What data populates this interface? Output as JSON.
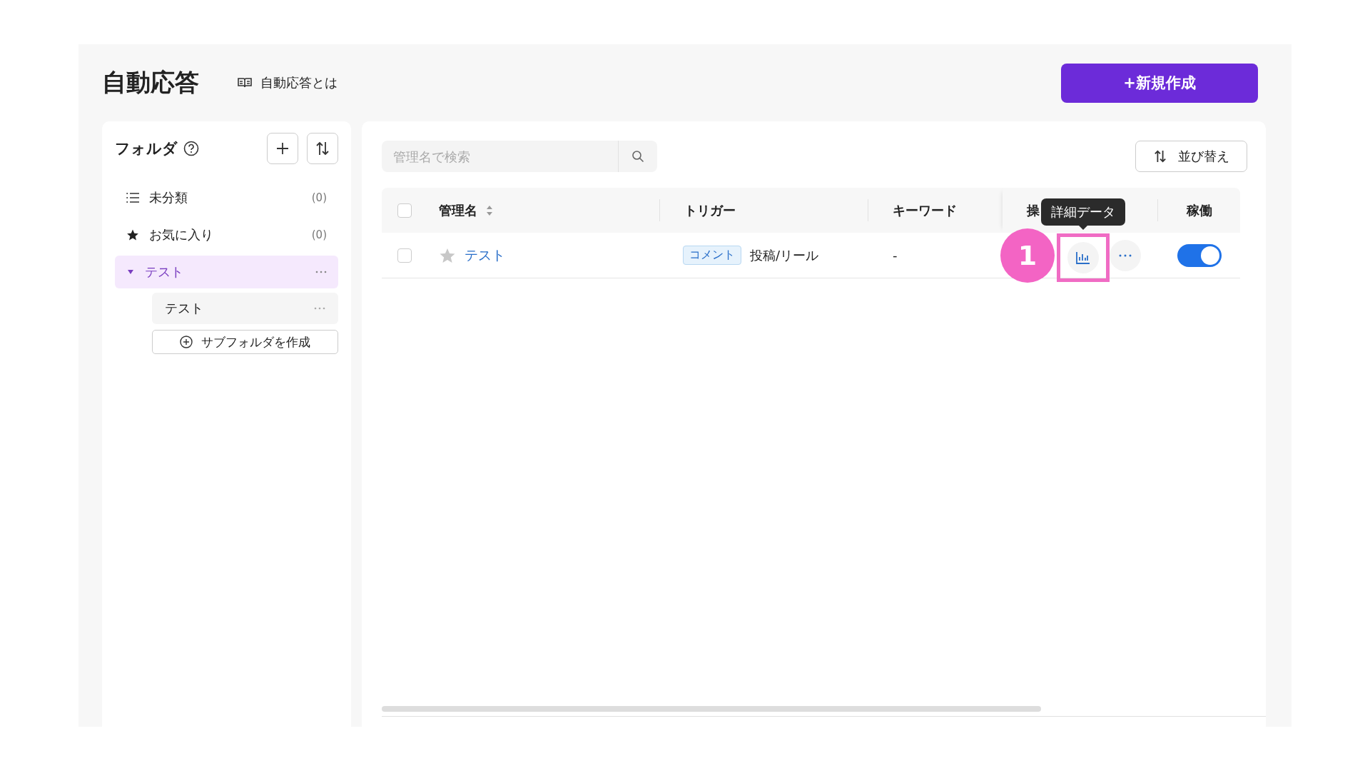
{
  "page": {
    "title": "自動応答",
    "help_link": "自動応答とは",
    "new_button": "+新規作成"
  },
  "sidebar": {
    "title": "フォルダ",
    "items": [
      {
        "kind": "uncategorized",
        "label": "未分類",
        "count": "(0)",
        "selected": false
      },
      {
        "kind": "favorites",
        "label": "お気に入り",
        "count": "(0)",
        "selected": false
      },
      {
        "kind": "folder",
        "label": "テスト",
        "expanded": true,
        "selected": true,
        "children": [
          {
            "label": "テスト",
            "selected": false
          }
        ]
      }
    ],
    "create_subfolder": "サブフォルダを作成"
  },
  "search": {
    "placeholder": "管理名で検索"
  },
  "sort_button": "並び替え",
  "table": {
    "select_all": false,
    "columns": [
      "管理名",
      "トリガー",
      "キーワード",
      "操",
      "稼働"
    ],
    "rows": [
      {
        "checked": false,
        "favorite": false,
        "name": "テスト",
        "trigger_tag": "コメント",
        "trigger": "投稿/リール",
        "keyword": "-",
        "on": true
      }
    ]
  },
  "tooltip": "詳細データ",
  "callout": "1"
}
